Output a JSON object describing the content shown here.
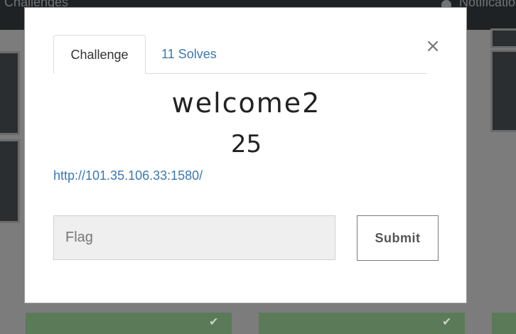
{
  "background": {
    "nav_brand": "Challenges",
    "nav_notifications": "Notifications",
    "icons": {
      "user": "user-icon",
      "check": "check-icon"
    },
    "check_glyph": "✔"
  },
  "modal": {
    "close_glyph": "×",
    "tabs": [
      {
        "label": "Challenge",
        "active": true
      },
      {
        "label": "11 Solves",
        "active": false
      }
    ],
    "challenge": {
      "name": "welcome2",
      "points": "25",
      "link": "http://101.35.106.33:1580/"
    },
    "flag_input": {
      "placeholder": "Flag",
      "value": ""
    },
    "submit_label": "Submit"
  },
  "colors": {
    "link": "#3b78b2",
    "overlay": "#7c7c7c",
    "solved": "#5a7a58"
  }
}
